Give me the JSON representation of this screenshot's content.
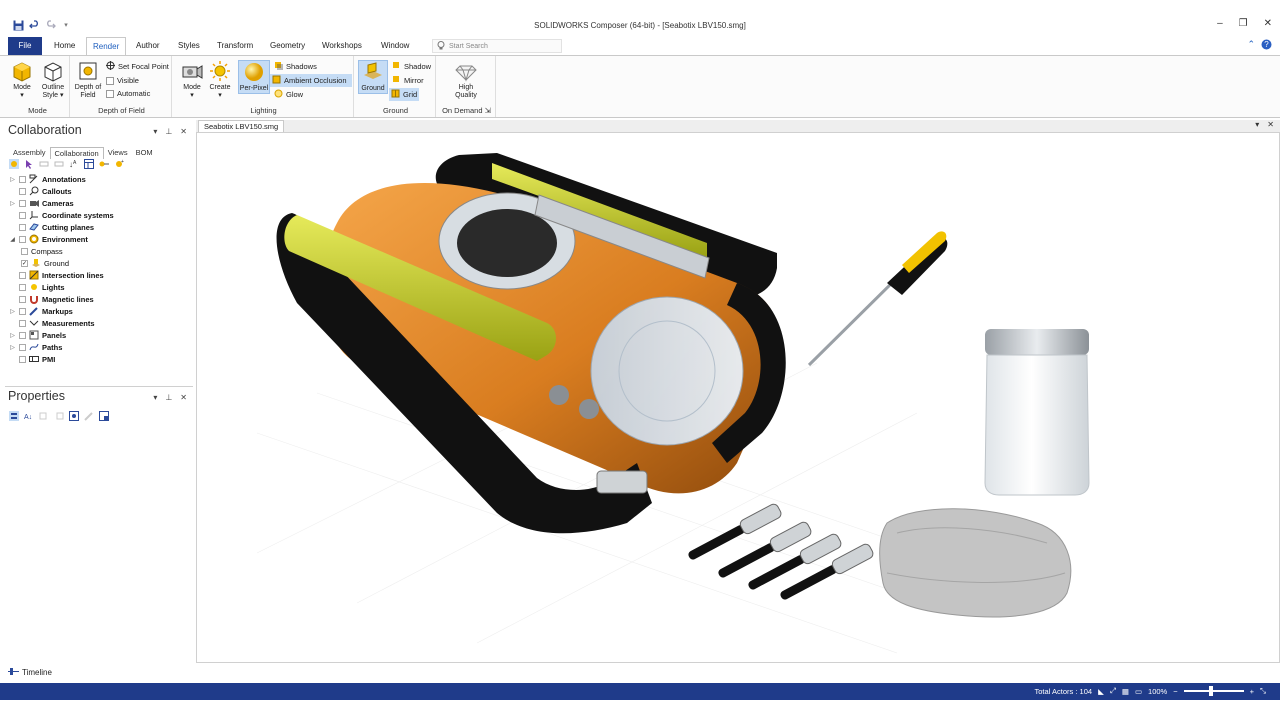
{
  "window": {
    "title": "SOLIDWORKS Composer (64-bit) - [Seabotix LBV150.smg]",
    "controls": [
      "–",
      "❐",
      "✕"
    ]
  },
  "ribbon_tabs": {
    "file": "File",
    "items": [
      "Home",
      "Render",
      "Author",
      "Styles",
      "Transform",
      "Geometry",
      "Workshops",
      "Window"
    ],
    "active": "Render",
    "search_placeholder": "Start Search"
  },
  "ribbon": {
    "mode_group": {
      "label": "Mode",
      "mode": "Mode",
      "outline_style": "Outline Style"
    },
    "dof_group": {
      "label": "Depth of Field",
      "depth": "Depth of Field",
      "set_focal": "Set Focal Point",
      "visible": "Visible",
      "automatic": "Automatic"
    },
    "lighting_group": {
      "label": "Lighting",
      "mode": "Mode",
      "create": "Create",
      "per_pixel": "Per-Pixel",
      "shadows": "Shadows",
      "ambient": "Ambient Occlusion",
      "glow": "Glow"
    },
    "ground_group": {
      "label": "Ground",
      "ground": "Ground",
      "shadow": "Shadow",
      "mirror": "Mirror",
      "grid": "Grid"
    },
    "ondemand_group": {
      "label": "On Demand",
      "high_quality": "High Quality"
    }
  },
  "collaboration": {
    "title": "Collaboration",
    "tabs": [
      "Assembly",
      "Collaboration",
      "Views",
      "BOM"
    ],
    "tree": [
      {
        "label": "Annotations",
        "icon": "annotation-icon",
        "expand": true,
        "child": false
      },
      {
        "label": "Callouts",
        "icon": "callout-icon",
        "expand": false,
        "child": false
      },
      {
        "label": "Cameras",
        "icon": "camera-icon",
        "expand": true,
        "child": false
      },
      {
        "label": "Coordinate systems",
        "icon": "axes-icon",
        "expand": false,
        "child": false
      },
      {
        "label": "Cutting planes",
        "icon": "plane-icon",
        "expand": false,
        "child": false
      },
      {
        "label": "Environment",
        "icon": "environment-icon",
        "expand": true,
        "child": false
      },
      {
        "label": "Compass",
        "icon": "",
        "expand": false,
        "child": true
      },
      {
        "label": "Ground",
        "icon": "ground-icon",
        "expand": false,
        "child": true
      },
      {
        "label": "Intersection lines",
        "icon": "intersection-icon",
        "expand": false,
        "child": false
      },
      {
        "label": "Lights",
        "icon": "light-icon",
        "expand": false,
        "child": false
      },
      {
        "label": "Magnetic lines",
        "icon": "magnet-icon",
        "expand": false,
        "child": false
      },
      {
        "label": "Markups",
        "icon": "markup-icon",
        "expand": true,
        "child": false
      },
      {
        "label": "Measurements",
        "icon": "measure-icon",
        "expand": false,
        "child": false
      },
      {
        "label": "Panels",
        "icon": "panel-icon",
        "expand": true,
        "child": false
      },
      {
        "label": "Paths",
        "icon": "path-icon",
        "expand": true,
        "child": false
      },
      {
        "label": "PMI",
        "icon": "pmi-icon",
        "expand": false,
        "child": false
      }
    ]
  },
  "properties": {
    "title": "Properties"
  },
  "document": {
    "tab": "Seabotix LBV150.smg"
  },
  "timeline": {
    "label": "Timeline"
  },
  "status": {
    "total_actors": "Total Actors : 104",
    "zoom": "100%",
    "zoom_level": 0.45
  },
  "colors": {
    "accent": "#1f3b8a",
    "orange": "#e08a2c",
    "yellow": "#c9d12a",
    "selected": "#c5dcf5"
  }
}
